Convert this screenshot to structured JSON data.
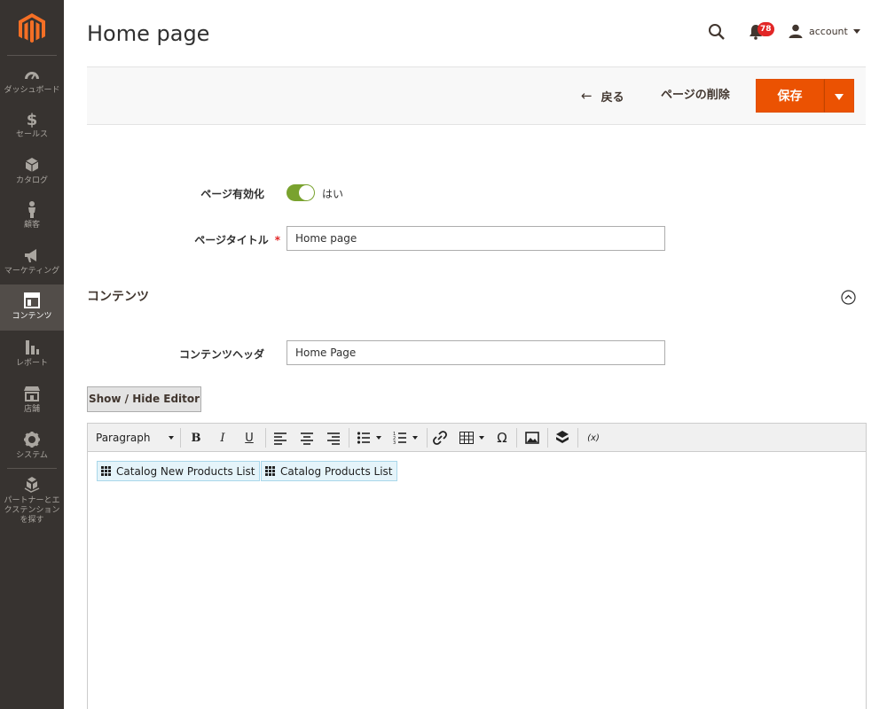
{
  "sidebar": {
    "items": [
      {
        "label": "ダッシュボード",
        "icon": "dashboard-icon"
      },
      {
        "label": "セールス",
        "icon": "dollar-icon"
      },
      {
        "label": "カタログ",
        "icon": "cube-icon"
      },
      {
        "label": "顧客",
        "icon": "person-icon"
      },
      {
        "label": "マーケティング",
        "icon": "megaphone-icon"
      },
      {
        "label": "コンテンツ",
        "icon": "layout-icon"
      },
      {
        "label": "レポート",
        "icon": "bar-chart-icon"
      },
      {
        "label": "店舗",
        "icon": "store-icon"
      },
      {
        "label": "システム",
        "icon": "gear-icon"
      },
      {
        "label": "パートナーとエ\nクステンション\nを探す",
        "icon": "boxes-icon"
      }
    ],
    "active": "コンテンツ"
  },
  "header": {
    "title": "Home page",
    "notifications_count": "78",
    "user_name": "account"
  },
  "actions": {
    "back": "戻る",
    "delete": "ページの削除",
    "save": "保存"
  },
  "form": {
    "enable_label": "ページ有効化",
    "enable_value": "はい",
    "title_label": "ページタイトル",
    "title_value": "Home page"
  },
  "content": {
    "section_title": "コンテンツ",
    "heading_label": "コンテンツヘッダ",
    "heading_value": "Home Page",
    "toggle_editor": "Show / Hide Editor"
  },
  "editor": {
    "format": "Paragraph",
    "widgets": [
      "Catalog New Products List",
      "Catalog Products List"
    ]
  },
  "colors": {
    "sidebar": "#373330",
    "accent": "#eb5202",
    "toggle_on": "#79a22e",
    "badge": "#e22626"
  }
}
